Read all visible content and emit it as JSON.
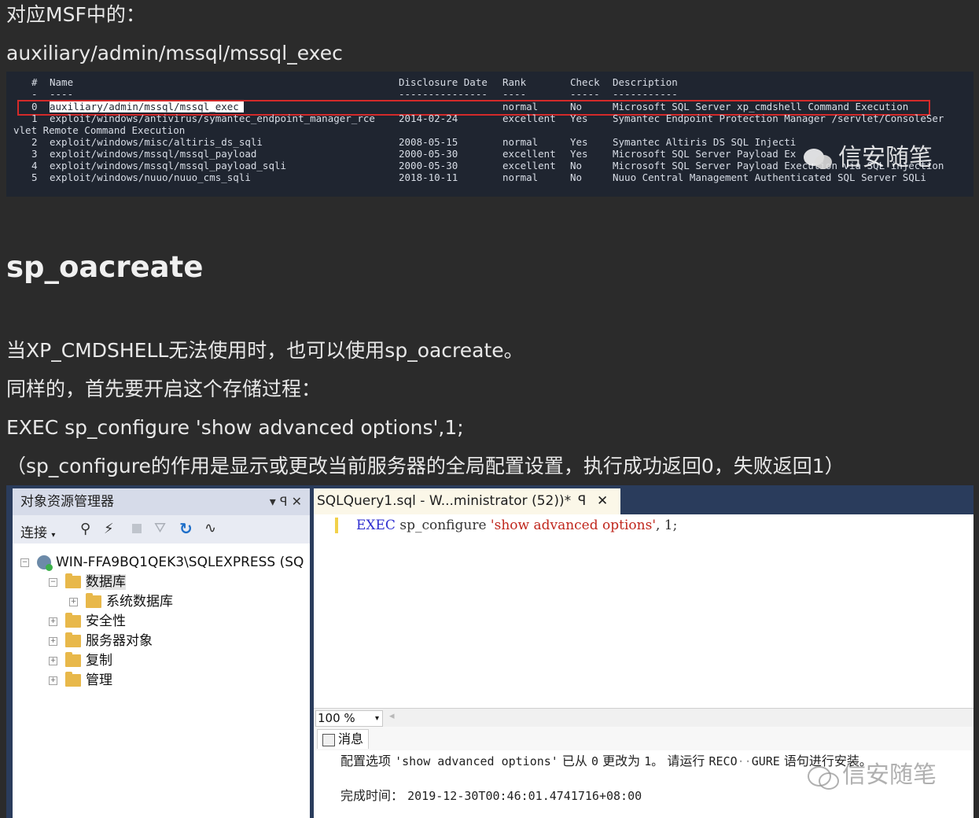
{
  "intro": {
    "line1": "对应MSF中的：",
    "line2": "auxiliary/admin/mssql/mssql_exec"
  },
  "terminal": {
    "headers": {
      "num": "#",
      "name": "Name",
      "date": "Disclosure Date",
      "rank": "Rank",
      "check": "Check",
      "desc": "Description"
    },
    "underline": {
      "num": "-",
      "name": "----",
      "date": "---------------",
      "rank": "----",
      "check": "-----",
      "desc": "-----------"
    },
    "rows": [
      {
        "num": "0",
        "name": "auxiliary/admin/mssql/mssql_exec",
        "date": "",
        "rank": "normal",
        "check": "No",
        "desc": "Microsoft SQL Server xp_cmdshell Command Execution"
      },
      {
        "num": "1",
        "name": "exploit/windows/antivirus/symantec_endpoint_manager_rce",
        "date": "2014-02-24",
        "rank": "excellent",
        "check": "Yes",
        "desc": "Symantec Endpoint Protection Manager /servlet/ConsoleSer"
      },
      {
        "num": "2",
        "name": "exploit/windows/misc/altiris_ds_sqli",
        "date": "2008-05-15",
        "rank": "normal",
        "check": "Yes",
        "desc": "Symantec Altiris DS SQL Injecti"
      },
      {
        "num": "3",
        "name": "exploit/windows/mssql/mssql_payload",
        "date": "2000-05-30",
        "rank": "excellent",
        "check": "Yes",
        "desc": "Microsoft SQL Server Payload Ex"
      },
      {
        "num": "4",
        "name": "exploit/windows/mssql/mssql_payload_sqli",
        "date": "2000-05-30",
        "rank": "excellent",
        "check": "No",
        "desc": "Microsoft SQL Server Payload Execution via SQL injection"
      },
      {
        "num": "5",
        "name": "exploit/windows/nuuo/nuuo_cms_sqli",
        "date": "2018-10-11",
        "rank": "normal",
        "check": "No",
        "desc": "Nuuo Central Management Authenticated SQL Server SQLi"
      }
    ],
    "wrap_line": "vlet Remote Command Execution"
  },
  "watermark": "信安随笔",
  "heading": "sp_oacreate",
  "paragraphs": {
    "p1": "当XP_CMDSHELL无法使用时，也可以使用sp_oacreate。",
    "p2": "同样的，首先要开启这个存储过程：",
    "p3": "EXEC sp_configure 'show advanced options',1;",
    "p4": "（sp_configure的作用是显示或更改当前服务器的全局配置设置，执行成功返回0，失败返回1）"
  },
  "ssms": {
    "object_explorer": {
      "title": "对象资源管理器",
      "title_pin": "▾ ꟼ ✕",
      "connect_label": "连接",
      "server": "WIN-FFA9BQ1QEK3\\SQLEXPRESS (SQ",
      "nodes": [
        "数据库",
        "系统数据库",
        "安全性",
        "服务器对象",
        "复制",
        "管理"
      ]
    },
    "query_tab": {
      "title": "SQLQuery1.sql - W...ministrator (52))*",
      "pin": "ꟼ",
      "close": "✕"
    },
    "query": {
      "kw_exec": "EXEC",
      "proc": "sp_configure",
      "str": "'show advanced options'",
      "rest": ", 1;"
    },
    "zoom": "100 %",
    "messages_tab": "消息",
    "message_prefix": "配置选项",
    "message_option": "'show advanced options'",
    "message_mid": "已从",
    "message_from": "0",
    "message_changed": "更改为",
    "message_to": "1。",
    "message_run": "请运行",
    "message_reconf": "RECO",
    "message_reconf2": "GURE",
    "message_tail": "语句进行安装。",
    "completion_label": "完成时间：",
    "completion_time": "2019-12-30T00:46:01.4741716+08:00"
  },
  "colors": {
    "page_bg": "#2b2b2b",
    "terminal_bg": "#1f2530",
    "highlight_box": "#d42a2a",
    "ssms_frame": "#2a3c5c",
    "sql_keyword": "#2f2fd0",
    "sql_string": "#c0261c"
  }
}
